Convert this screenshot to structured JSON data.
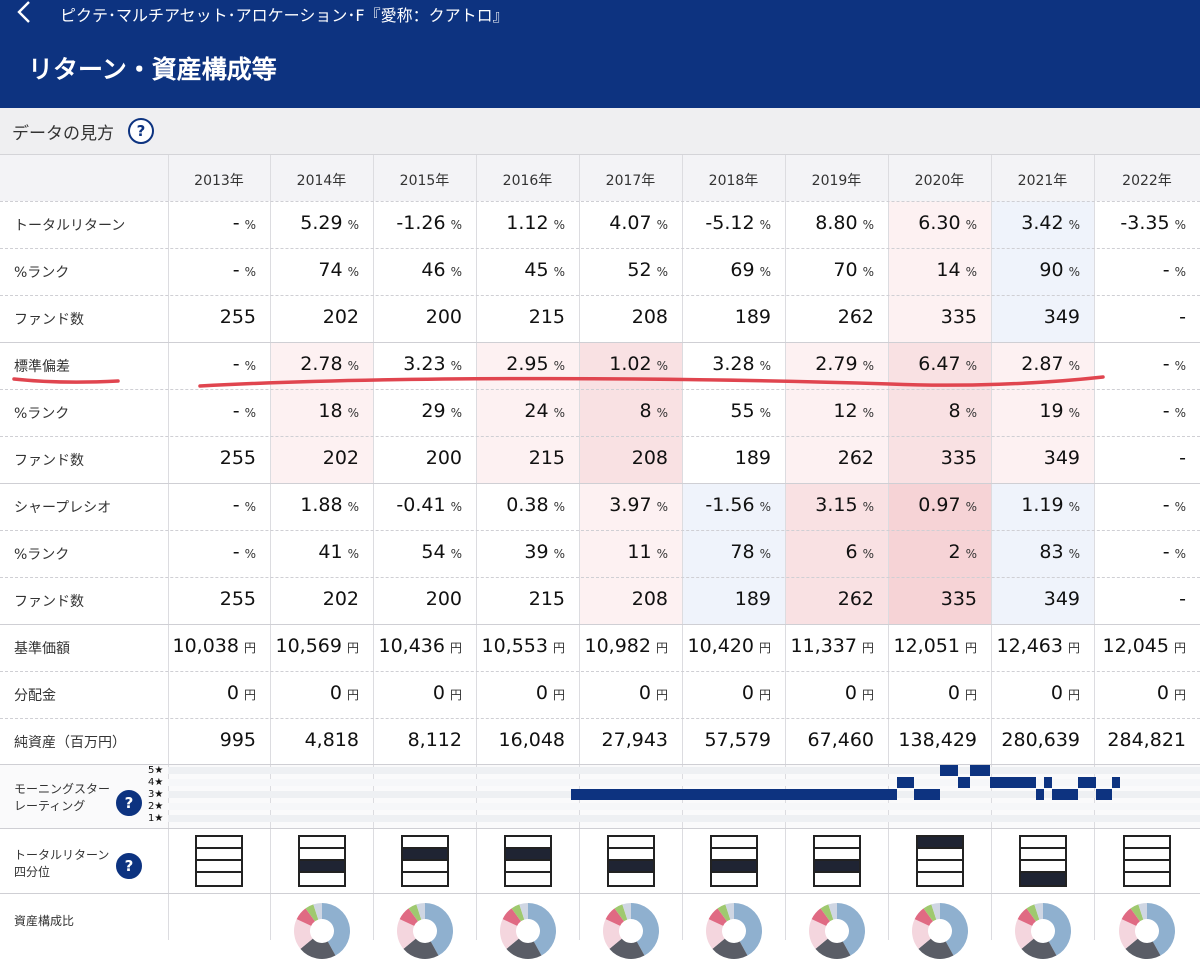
{
  "header": {
    "fund_name": "ピクテ･マルチアセット･アロケーション･F『愛称：クアトロ』",
    "page_title": "リターン・資産構成等"
  },
  "guide": {
    "label": "データの見方",
    "help_icon": "?"
  },
  "years": [
    "2013年",
    "2014年",
    "2015年",
    "2016年",
    "2017年",
    "2018年",
    "2019年",
    "2020年",
    "2021年",
    "2022年"
  ],
  "rows": [
    {
      "label": "トータルリターン",
      "unit": "%",
      "values": [
        "-",
        "5.29",
        "-1.26",
        "1.12",
        "4.07",
        "-5.12",
        "8.80",
        "6.30",
        "3.42",
        "-3.35"
      ]
    },
    {
      "label": "%ランク",
      "unit": "%",
      "values": [
        "-",
        "74",
        "46",
        "45",
        "52",
        "69",
        "70",
        "14",
        "90",
        "-"
      ]
    },
    {
      "label": "ファンド数",
      "unit": "",
      "values": [
        "255",
        "202",
        "200",
        "215",
        "208",
        "189",
        "262",
        "335",
        "349",
        "-"
      ]
    },
    {
      "label": "標準偏差",
      "unit": "%",
      "values": [
        "-",
        "2.78",
        "3.23",
        "2.95",
        "1.02",
        "3.28",
        "2.79",
        "6.47",
        "2.87",
        "-"
      ]
    },
    {
      "label": "%ランク",
      "unit": "%",
      "values": [
        "-",
        "18",
        "29",
        "24",
        "8",
        "55",
        "12",
        "8",
        "19",
        "-"
      ]
    },
    {
      "label": "ファンド数",
      "unit": "",
      "values": [
        "255",
        "202",
        "200",
        "215",
        "208",
        "189",
        "262",
        "335",
        "349",
        "-"
      ]
    },
    {
      "label": "シャープレシオ",
      "unit": "%",
      "values": [
        "-",
        "1.88",
        "-0.41",
        "0.38",
        "3.97",
        "-1.56",
        "3.15",
        "0.97",
        "1.19",
        "-"
      ]
    },
    {
      "label": "%ランク",
      "unit": "%",
      "values": [
        "-",
        "41",
        "54",
        "39",
        "11",
        "78",
        "6",
        "2",
        "83",
        "-"
      ]
    },
    {
      "label": "ファンド数",
      "unit": "",
      "values": [
        "255",
        "202",
        "200",
        "215",
        "208",
        "189",
        "262",
        "335",
        "349",
        "-"
      ]
    },
    {
      "label": "基準価額",
      "unit": "円",
      "values": [
        "10,038",
        "10,569",
        "10,436",
        "10,553",
        "10,982",
        "10,420",
        "11,337",
        "12,051",
        "12,463",
        "12,045"
      ]
    },
    {
      "label": "分配金",
      "unit": "円",
      "values": [
        "0",
        "0",
        "0",
        "0",
        "0",
        "0",
        "0",
        "0",
        "0",
        "0"
      ]
    },
    {
      "label": "純資産（百万円）",
      "unit": "",
      "values": [
        "995",
        "4,818",
        "8,112",
        "16,048",
        "27,943",
        "57,579",
        "67,460",
        "138,429",
        "280,639",
        "284,821"
      ]
    }
  ],
  "rating": {
    "label_line1": "モーニングスター",
    "label_line2": "レーティング",
    "star_labels": [
      "5★",
      "4★",
      "3★",
      "2★",
      "1★"
    ],
    "help_icon": "?"
  },
  "quartile": {
    "label_line1": "トータルリターン",
    "label_line2": "四分位",
    "help_icon": "?",
    "filled_quartile": [
      null,
      3,
      2,
      2,
      3,
      3,
      3,
      1,
      4,
      null
    ]
  },
  "asset": {
    "label": "資産構成比"
  },
  "colors": {
    "header_bg": "#0d3380",
    "pink_light": "#fdf1f2",
    "pink_mid": "#f9e1e3",
    "pink_strong": "#f6d3d6",
    "blue_light": "#eff3fb",
    "rating_bar": "#0d3380",
    "annotation_red": "#e0454f"
  }
}
